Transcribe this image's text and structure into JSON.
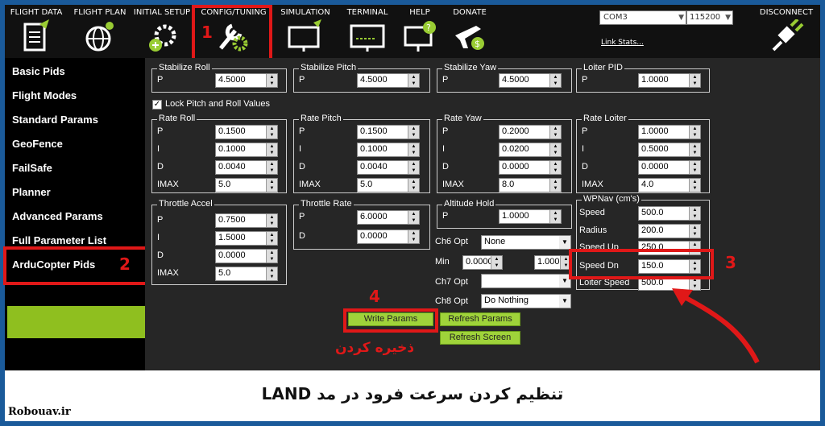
{
  "toolbar": {
    "items": [
      {
        "label": "FLIGHT DATA",
        "icon": "clipboard-icon"
      },
      {
        "label": "FLIGHT PLAN",
        "icon": "globe-icon"
      },
      {
        "label": "INITIAL SETUP",
        "icon": "gear-plus-icon"
      },
      {
        "label": "CONFIG/TUNING",
        "icon": "wrench-gear-icon"
      },
      {
        "label": "SIMULATION",
        "icon": "monitor-plane-icon"
      },
      {
        "label": "TERMINAL",
        "icon": "terminal-icon"
      },
      {
        "label": "HELP",
        "icon": "help-monitor-icon"
      },
      {
        "label": "DONATE",
        "icon": "plane-dollar-icon"
      }
    ],
    "com_port": "COM3",
    "baud": "115200",
    "link_stats": "Link Stats...",
    "disconnect": "DISCONNECT"
  },
  "sidebar": [
    "Basic Pids",
    "Flight Modes",
    "Standard Params",
    "GeoFence",
    "FailSafe",
    "Planner",
    "Advanced Params",
    "Full Parameter List",
    "ArduCopter Pids"
  ],
  "groups": {
    "stab_roll": {
      "title": "Stabilize Roll",
      "p": "4.5000"
    },
    "stab_pitch": {
      "title": "Stabilize Pitch",
      "p": "4.5000"
    },
    "stab_yaw": {
      "title": "Stabilize Yaw",
      "p": "4.5000"
    },
    "loiter_pid": {
      "title": "Loiter PID",
      "p": "1.0000"
    },
    "lock": "Lock Pitch and Roll Values",
    "rate_roll": {
      "title": "Rate Roll",
      "p": "0.1500",
      "i": "0.1000",
      "d": "0.0040",
      "imax": "5.0"
    },
    "rate_pitch": {
      "title": "Rate Pitch",
      "p": "0.1500",
      "i": "0.1000",
      "d": "0.0040",
      "imax": "5.0"
    },
    "rate_yaw": {
      "title": "Rate Yaw",
      "p": "0.2000",
      "i": "0.0200",
      "d": "0.0000",
      "imax": "8.0"
    },
    "rate_loiter": {
      "title": "Rate Loiter",
      "p": "1.0000",
      "i": "0.5000",
      "d": "0.0000",
      "imax": "4.0"
    },
    "thr_accel": {
      "title": "Throttle Accel",
      "p": "0.7500",
      "i": "1.5000",
      "d": "0.0000",
      "imax": "5.0"
    },
    "thr_rate": {
      "title": "Throttle Rate",
      "p": "6.0000",
      "d": "0.0000"
    },
    "alt_hold": {
      "title": "Altitude Hold",
      "p": "1.0000"
    },
    "wpnav": {
      "title": "WPNav (cm's)",
      "speed": "500.0",
      "radius": "200.0",
      "speed_up": "250.0",
      "speed_dn": "150.0",
      "loiter_speed": "500.0"
    }
  },
  "labels": {
    "p": "P",
    "i": "I",
    "d": "D",
    "imax": "IMAX",
    "speed": "Speed",
    "radius": "Radius",
    "speed_up": "Speed Up",
    "speed_dn": "Speed Dn",
    "loiter_speed": "Loiter Speed",
    "ch6": "Ch6 Opt",
    "min": "Min",
    "ch7": "Ch7 Opt",
    "ch8": "Ch8 Opt"
  },
  "ch6_value": "None",
  "min_value": "0.0000",
  "max_value": "1.000",
  "ch7_value": "",
  "ch8_value": "Do Nothing",
  "buttons": {
    "write": "Write Params",
    "refresh": "Refresh Params",
    "refresh_screen": "Refresh Screen"
  },
  "annotations": {
    "n1": "1",
    "n2": "2",
    "n3": "3",
    "n4": "4",
    "save": "ذخیره کردن"
  },
  "caption": "تنظیم کردن سرعت فرود در مد LAND",
  "site": "Robouav.ir"
}
